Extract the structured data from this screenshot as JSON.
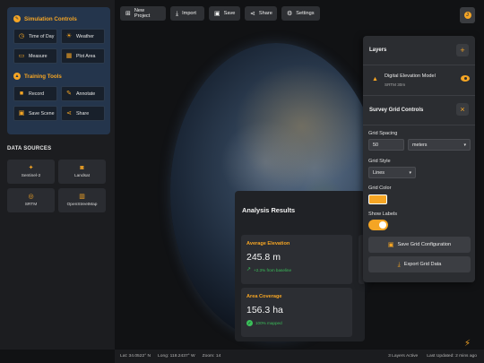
{
  "sidebar": {
    "simulation_title": "Simulation Controls",
    "simulation_buttons": [
      {
        "label": "Time of Day",
        "icon": "clock-icon"
      },
      {
        "label": "Weather",
        "icon": "weather-icon"
      },
      {
        "label": "Measure",
        "icon": "ruler-icon"
      },
      {
        "label": "Plot Area",
        "icon": "plot-area-icon"
      }
    ],
    "training_title": "Training Tools",
    "training_buttons": [
      {
        "label": "Record",
        "icon": "video-camera-icon"
      },
      {
        "label": "Annotate",
        "icon": "pencil-icon"
      },
      {
        "label": "Save Scene",
        "icon": "floppy-icon"
      },
      {
        "label": "Share",
        "icon": "share-icon"
      }
    ],
    "data_sources_title": "DATA SOURCES",
    "data_sources": [
      {
        "label": "Sentinel-2",
        "icon": "satellite-icon"
      },
      {
        "label": "Landsat",
        "icon": "camera-icon"
      },
      {
        "label": "SRTM",
        "icon": "target-icon"
      },
      {
        "label": "OpenStreetMap",
        "icon": "map-icon"
      }
    ]
  },
  "toolbar": {
    "new_project": "New Project",
    "import": "Import",
    "save": "Save",
    "share": "Share",
    "settings": "Settings",
    "user_initial": "J"
  },
  "layers_panel": {
    "title": "Layers",
    "add_icon": "+",
    "layer": {
      "name": "Digital Elevation Model",
      "meta": "SRTM 30m",
      "icon": "mountain-icon"
    }
  },
  "grid_controls": {
    "title": "Survey Grid Controls",
    "close_icon": "×",
    "spacing_label": "Grid Spacing",
    "spacing_value": "50",
    "spacing_unit": "meters",
    "style_label": "Grid Style",
    "style_value": "Lines",
    "color_label": "Grid Color",
    "color_value": "#f5a524",
    "labels_label": "Show Labels",
    "labels_on": true,
    "save_button": "Save Grid Configuration",
    "export_button": "Export Grid Data"
  },
  "analysis": {
    "title": "Analysis Results",
    "metrics": [
      {
        "label": "Average Elevation",
        "value": "245.8 m",
        "sub": "+2.3% from baseline"
      },
      {
        "label": "Area Coverage",
        "value": "156.3 ha",
        "sub": "100% mapped"
      }
    ]
  },
  "status": {
    "lat": "Lat: 34.0522° N",
    "long": "Long: 118.2437° W",
    "zoom": "Zoom: 14",
    "layers_active": "3 Layers Active",
    "last_updated": "Last Updated: 2 mins ago"
  },
  "colors": {
    "accent": "#f5a524",
    "success": "#3bbf5a",
    "panel_blue": "#24354c"
  }
}
